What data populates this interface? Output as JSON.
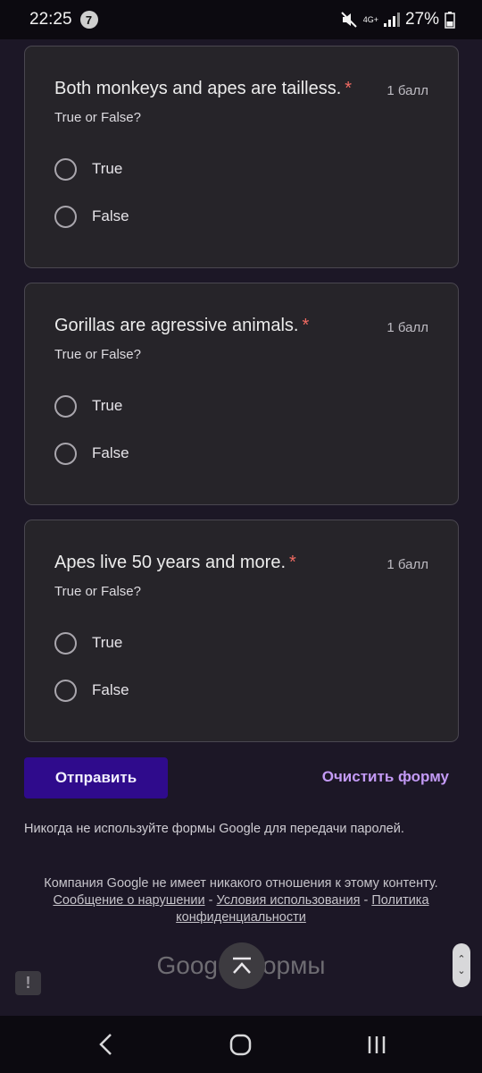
{
  "status_bar": {
    "time": "22:25",
    "notification_count": "7",
    "network": "4G+",
    "battery": "27%"
  },
  "questions": [
    {
      "title": "Both monkeys and apes are tailless.",
      "required_mark": "*",
      "points": "1 балл",
      "description": "True or False?",
      "options": [
        "True",
        "False"
      ]
    },
    {
      "title": "Gorillas are agressive animals.",
      "required_mark": "*",
      "points": "1 балл",
      "description": "True or False?",
      "options": [
        "True",
        "False"
      ]
    },
    {
      "title": "Apes live 50 years and more.",
      "required_mark": "*",
      "points": "1 балл",
      "description": "True or False?",
      "options": [
        "True",
        "False"
      ]
    }
  ],
  "actions": {
    "submit_label": "Отправить",
    "clear_label": "Очистить форму"
  },
  "footer": {
    "password_notice": "Никогда не используйте формы Google для передачи паролей.",
    "legal_text": "Компания Google не имеет никакого отношения к этому контенту.",
    "report_link": "Сообщение о нарушении",
    "terms_link": "Условия использования",
    "privacy_link": "Политика конфиденциальности",
    "separator": "-",
    "logo_left": "Goog",
    "logo_right": "ормы"
  },
  "colors": {
    "background": "#1c1726",
    "card": "#262429",
    "submit": "#2f0b8c",
    "clear_link": "#c39af5",
    "required": "#ef6a62"
  },
  "icons": [
    "mute-icon",
    "signal-icon",
    "battery-icon",
    "scroll-to-top-icon",
    "report-icon",
    "back-icon",
    "home-icon",
    "recents-icon"
  ]
}
